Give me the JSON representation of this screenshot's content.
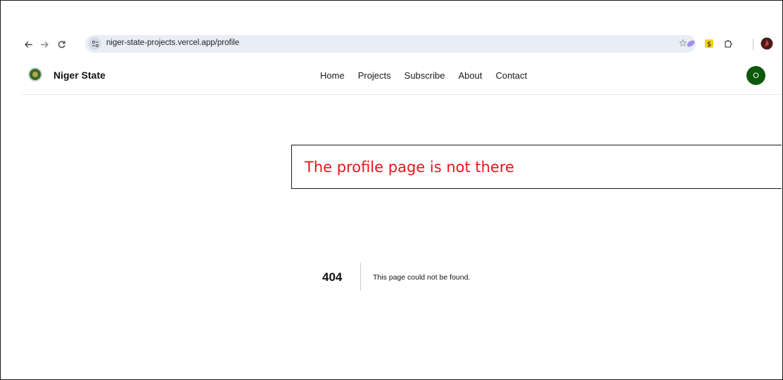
{
  "browser": {
    "back_icon": "arrow-left-icon",
    "forward_icon": "arrow-right-icon",
    "reload_icon": "reload-icon",
    "site_info_icon": "tune-icon",
    "url": "niger-state-projects.vercel.app/profile",
    "bookmark_icon": "star-icon",
    "extensions": [
      "feather-extension-icon",
      "yellow-extension-icon",
      "puzzle-icon"
    ],
    "profile_icon": "profile-avatar-icon"
  },
  "header": {
    "brand": "Niger State",
    "nav": [
      "Home",
      "Projects",
      "Subscribe",
      "About",
      "Contact"
    ],
    "avatar_letter": "O"
  },
  "annotation": {
    "text": "The profile page is not there",
    "color": "#e8141b"
  },
  "error": {
    "code": "404",
    "message": "This page could not be found."
  },
  "colors": {
    "avatar_bg": "#0b5a0b",
    "omnibox_bg": "#e9edf6"
  }
}
